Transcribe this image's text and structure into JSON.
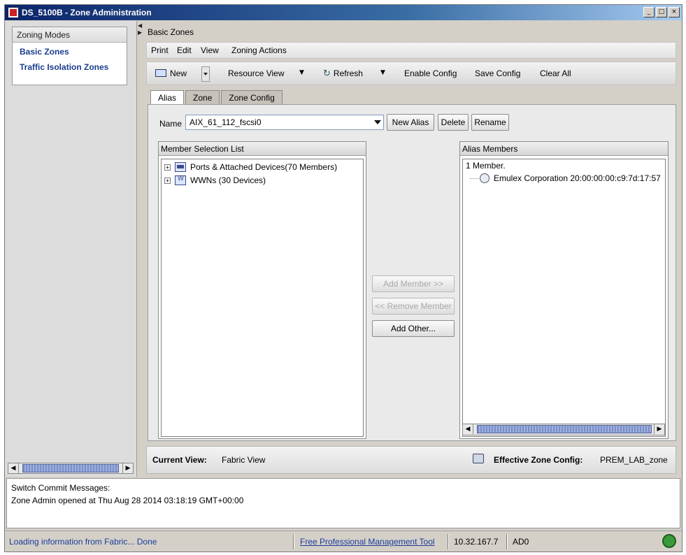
{
  "window": {
    "title": "DS_5100B - Zone Administration",
    "minimize": "_",
    "maximize": "□",
    "close": "×"
  },
  "zoning_modes": {
    "header": "Zoning Modes",
    "items": [
      {
        "label": "Basic Zones"
      },
      {
        "label": "Traffic Isolation Zones"
      }
    ]
  },
  "main": {
    "title": "Basic Zones",
    "menu": {
      "print": "Print",
      "edit": "Edit",
      "view": "View",
      "zoning_actions": "Zoning Actions"
    },
    "toolbar": {
      "new": "New",
      "resource_view": "Resource View",
      "refresh": "Refresh",
      "enable_config": "Enable Config",
      "save_config": "Save Config",
      "clear_all": "Clear All"
    },
    "tabs": [
      {
        "label": "Alias"
      },
      {
        "label": "Zone"
      },
      {
        "label": "Zone Config"
      }
    ],
    "alias": {
      "name_label": "Name",
      "name_value": "AIX_61_112_fscsi0",
      "new_alias": "New Alias",
      "delete": "Delete",
      "rename": "Rename"
    },
    "member_selection": {
      "header": "Member Selection List",
      "items": [
        {
          "expander": "+",
          "label": "Ports & Attached Devices(70 Members)"
        },
        {
          "expander": "+",
          "label": "WWNs (30 Devices)"
        }
      ]
    },
    "actions": {
      "add_member": "Add Member >>",
      "remove_member": "<< Remove Member",
      "add_other": "Add Other..."
    },
    "alias_members": {
      "header": "Alias Members",
      "count": "1 Member.",
      "items": [
        {
          "label": "Emulex Corporation 20:00:00:00:c9:7d:17:57"
        }
      ]
    },
    "status": {
      "current_view_label": "Current View:",
      "current_view_value": "Fabric View",
      "effective_label": "Effective Zone Config:",
      "effective_value": "PREM_LAB_zone"
    }
  },
  "messages": {
    "header": "Switch Commit Messages:",
    "lines": [
      "Zone Admin opened at Thu Aug 28 2014 03:18:19 GMT+00:00"
    ]
  },
  "statusbar": {
    "loading": "Loading information from Fabric... Done",
    "link": "Free Professional Management Tool",
    "ip": "10.32.167.7",
    "ad": "AD0"
  },
  "colors": {
    "link_blue": "#1a3c9a",
    "titlebar": "#0a246a"
  }
}
